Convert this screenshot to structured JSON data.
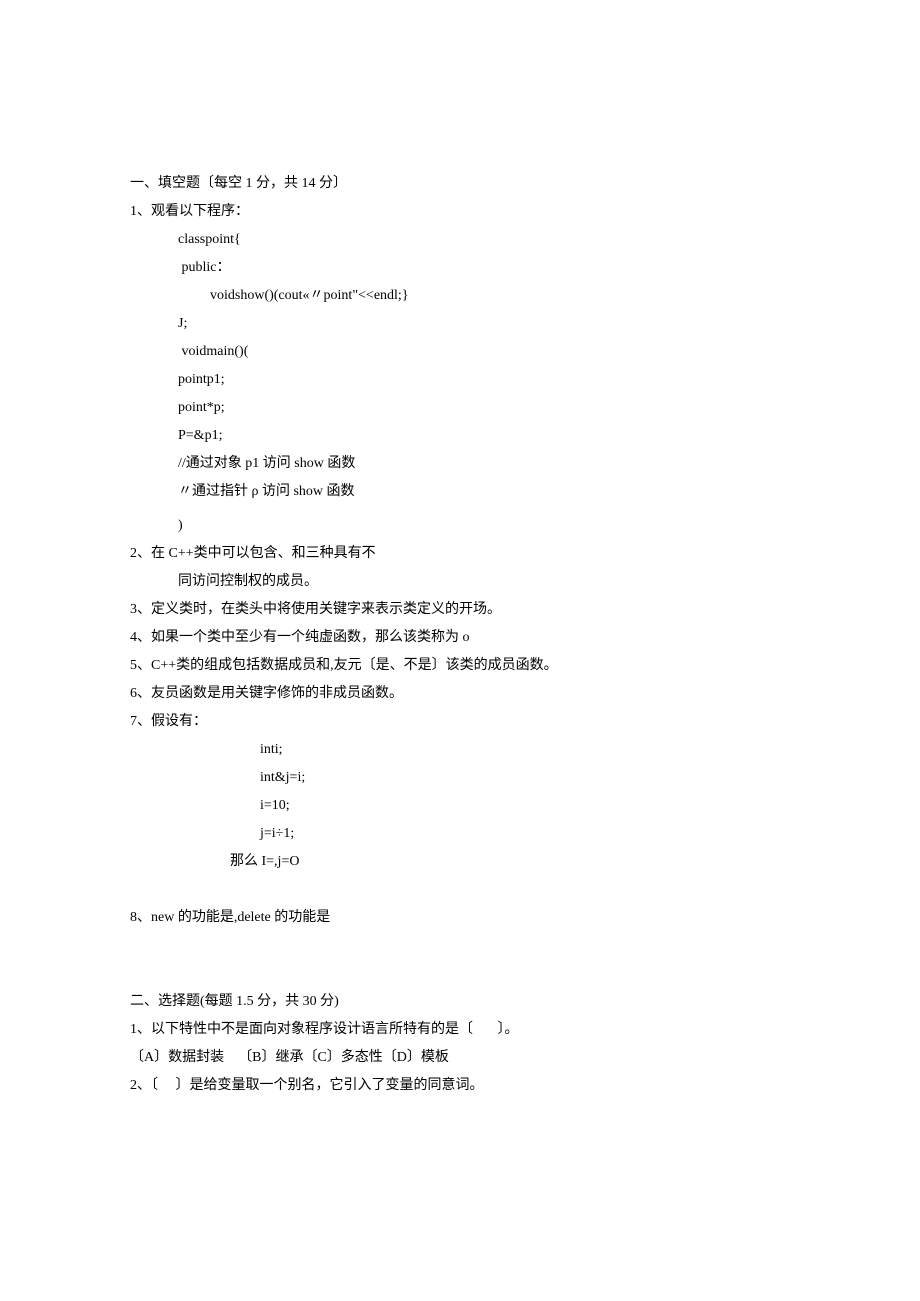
{
  "s1_title": "一、填空题〔每空 1 分，共 14 分〕",
  "q1_stem": "1、观看以下程序：",
  "q1_l1": "classpoint{",
  "q1_l2": " public：",
  "q1_l3": "voidshow()(cout«〃point\"<<endl;}",
  "q1_l4": "J;",
  "q1_l5": " voidmain()(",
  "q1_l6": "pointp1;",
  "q1_l7": "point*p;",
  "q1_l8": "P=&p1;",
  "q1_l9": "//通过对象 p1 访问 show 函数",
  "q1_l10": "〃通过指针 ρ 访问 show 函数",
  "q1_l11": ")",
  "q2_l1": "2、在 C++类中可以包含、和三种具有不",
  "q2_l2": "同访问控制权的成员。",
  "q3": "3、定义类时，在类头中将使用关键字来表示类定义的开场。",
  "q4": "4、如果一个类中至少有一个纯虚函数，那么该类称为 o",
  "q5": "5、C++类的组成包括数据成员和,友元〔是、不是〕该类的成员函数。",
  "q6": "6、友员函数是用关键字修饰的非成员函数。",
  "q7_stem": "7、假设有：",
  "q7_l1": "inti;",
  "q7_l2": "int&j=i;",
  "q7_l3": "i=10;",
  "q7_l4": "j=i÷1;",
  "q7_l5": "那么 I=,j=O",
  "q8": "8、new 的功能是,delete 的功能是",
  "s2_title": "二、选择题(每题 1.5 分，共 30 分)",
  "s2_q1": "1、以下特性中不是面向对象程序设计语言所特有的是〔       〕。",
  "s2_q1_opts": "〔A〕数据封装    〔B〕继承〔C〕多态性〔D〕模板",
  "s2_q2": "2、〔     〕是给变量取一个别名，它引入了变量的同意词。"
}
